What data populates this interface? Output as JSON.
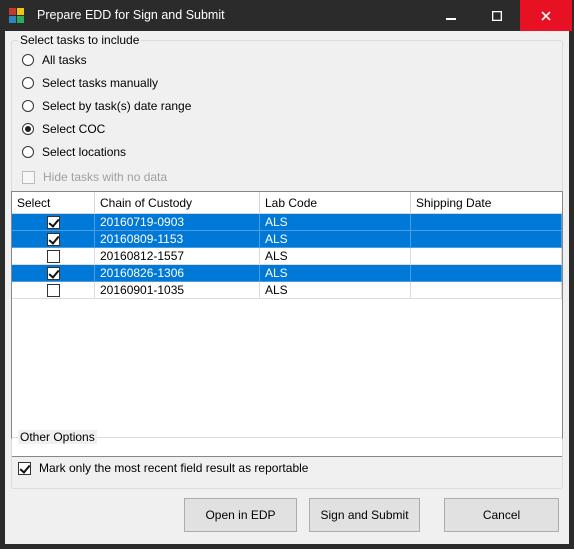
{
  "window": {
    "title": "Prepare EDD for Sign and Submit",
    "colors": {
      "titlebar": "#2b2b2b",
      "close_hover": "#e81123",
      "selection": "#0078d7"
    }
  },
  "select_tasks": {
    "group_title": "Select tasks to include",
    "options": [
      {
        "label": "All tasks",
        "checked": false
      },
      {
        "label": "Select tasks manually",
        "checked": false
      },
      {
        "label": "Select by task(s) date range",
        "checked": false
      },
      {
        "label": "Select COC",
        "checked": true
      },
      {
        "label": "Select locations",
        "checked": false
      }
    ],
    "hide_tasks_label": "Hide tasks with no data"
  },
  "grid": {
    "columns": [
      "Select",
      "Chain of Custody",
      "Lab Code",
      "Shipping Date"
    ],
    "rows": [
      {
        "checked": true,
        "coc": "20160719-0903",
        "lab": "ALS",
        "ship": "",
        "selected": true
      },
      {
        "checked": true,
        "coc": "20160809-1153",
        "lab": "ALS",
        "ship": "",
        "selected": true
      },
      {
        "checked": false,
        "coc": "20160812-1557",
        "lab": "ALS",
        "ship": "",
        "selected": false
      },
      {
        "checked": true,
        "coc": "20160826-1306",
        "lab": "ALS",
        "ship": "",
        "selected": true
      },
      {
        "checked": false,
        "coc": "20160901-1035",
        "lab": "ALS",
        "ship": "",
        "selected": false
      }
    ]
  },
  "other_options": {
    "group_title": "Other Options",
    "mark_recent_label": "Mark only the most recent field result as reportable",
    "mark_recent_checked": true
  },
  "buttons": {
    "open_edp": "Open in EDP",
    "sign_submit": "Sign and Submit",
    "cancel": "Cancel"
  }
}
